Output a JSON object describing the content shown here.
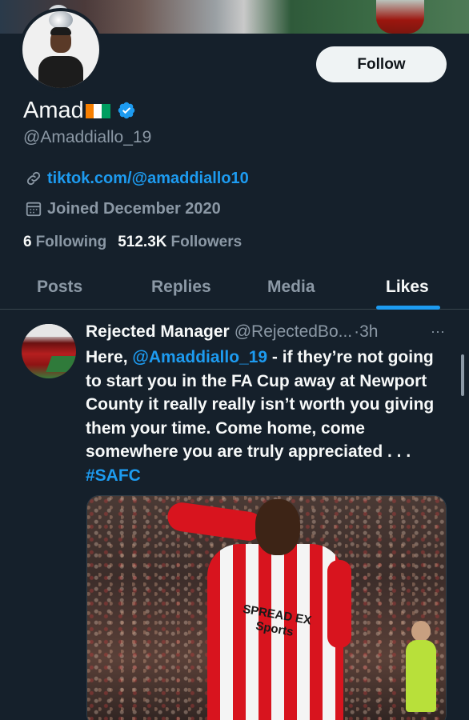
{
  "profile": {
    "name": "Amad",
    "flag_colors": [
      "#f77f00",
      "#ffffff",
      "#009e60"
    ],
    "verified_color": "#1d9bf0",
    "handle": "@Amaddiallo_19",
    "link": "tiktok.com/@amaddiallo10",
    "joined": "Joined December 2020",
    "following_count": "6",
    "following_label": "Following",
    "followers_count": "512.3K",
    "followers_label": "Followers",
    "follow_button": "Follow"
  },
  "tabs": [
    {
      "label": "Posts",
      "active": false
    },
    {
      "label": "Replies",
      "active": false
    },
    {
      "label": "Media",
      "active": false
    },
    {
      "label": "Likes",
      "active": true
    }
  ],
  "tweet": {
    "author": "Rejected Manager",
    "handle": "@RejectedBo...",
    "time": "·3h",
    "more": "···",
    "text_prefix": "Here, ",
    "mention": "@Amaddiallo_19",
    "text_body": " - if they’re not going to start you in the FA Cup away at Newport County it really really isn’t worth you giving them your time. Come home, come somewhere you are truly appreciated . . . ",
    "hashtag": "#SAFC",
    "media_sponsor_line1": "SPREAD EX",
    "media_sponsor_line2": "Sports"
  },
  "icons": {
    "link": "link-icon",
    "calendar": "calendar-icon",
    "verified": "verified-badge-icon",
    "more": "more-options-icon"
  }
}
